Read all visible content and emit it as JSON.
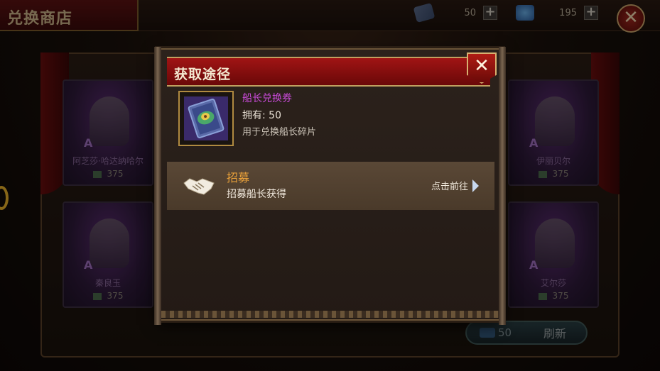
{
  "shop": {
    "title": "兑换商店",
    "currency_ticket": {
      "icon": "ticket-icon",
      "value": "50"
    },
    "currency_gem": {
      "icon": "gem-icon",
      "value": "195"
    },
    "plus_label": "+",
    "close_label": "✕"
  },
  "cards": [
    {
      "name": "阿芝莎·哈达纳哈尔",
      "rank": "A",
      "price": "375"
    },
    {
      "name": "秦良玉",
      "rank": "A",
      "price": "375"
    },
    {
      "name": "伊丽贝尔",
      "rank": "A",
      "price": "375"
    },
    {
      "name": "艾尔莎",
      "rank": "A",
      "price": "375"
    }
  ],
  "refresh": {
    "cost": "50",
    "label": "刷新"
  },
  "popup": {
    "title": "获取途径",
    "close_label": "✕",
    "item": {
      "name": "船长兑换券",
      "owned": "拥有: 50",
      "desc": "用于兑换船长碎片"
    },
    "sources": [
      {
        "title": "招募",
        "desc": "招募船长获得",
        "action": "点击前往"
      }
    ]
  },
  "colors": {
    "header_red": "#a01414",
    "item_name_purple": "#c84ad8",
    "source_title_orange": "#e8a03a",
    "frame_gold": "#b08a40"
  }
}
